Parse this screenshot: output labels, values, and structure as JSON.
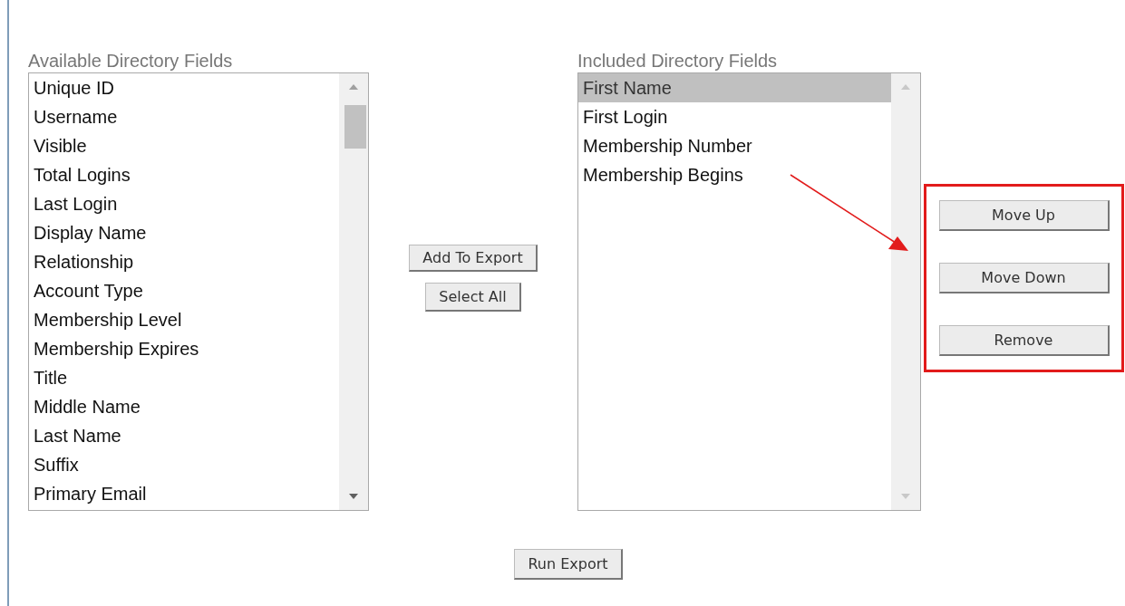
{
  "available": {
    "label": "Available Directory Fields",
    "items": [
      {
        "label": "Unique ID",
        "selected": false
      },
      {
        "label": "Username",
        "selected": false
      },
      {
        "label": "Visible",
        "selected": false
      },
      {
        "label": "Total Logins",
        "selected": false
      },
      {
        "label": "Last Login",
        "selected": false
      },
      {
        "label": "Display Name",
        "selected": false
      },
      {
        "label": "Relationship",
        "selected": false
      },
      {
        "label": "Account Type",
        "selected": false
      },
      {
        "label": "Membership Level",
        "selected": false
      },
      {
        "label": "Membership Expires",
        "selected": false
      },
      {
        "label": "Title",
        "selected": false
      },
      {
        "label": "Middle Name",
        "selected": false
      },
      {
        "label": "Last Name",
        "selected": false
      },
      {
        "label": "Suffix",
        "selected": false
      },
      {
        "label": "Primary Email",
        "selected": false
      }
    ]
  },
  "middle_buttons": [
    "Add To Export",
    "Select All"
  ],
  "included": {
    "label": "Included Directory Fields",
    "items": [
      {
        "label": "First Name",
        "selected": true
      },
      {
        "label": "First Login",
        "selected": false
      },
      {
        "label": "Membership Number",
        "selected": false
      },
      {
        "label": "Membership Begins",
        "selected": false
      }
    ]
  },
  "reorder_buttons": {
    "highlighted": true,
    "items": [
      "Move Up",
      "Move Down",
      "Remove"
    ]
  },
  "run_button": "Run Export"
}
